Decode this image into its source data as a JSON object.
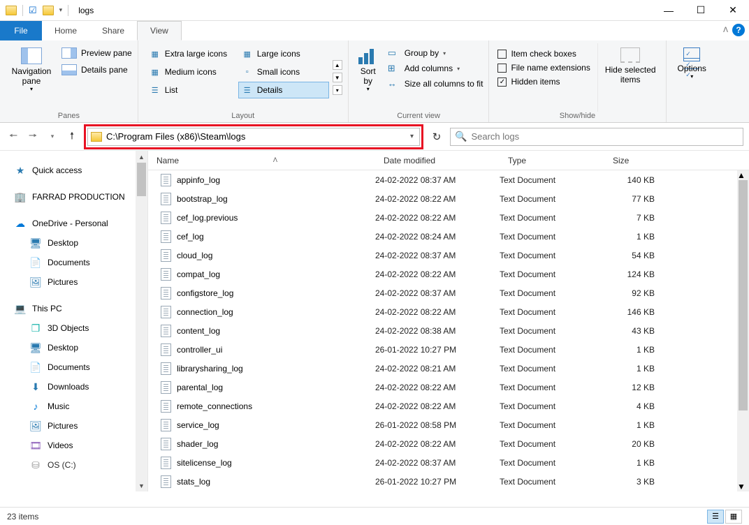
{
  "titlebar": {
    "title": "logs"
  },
  "tabs": {
    "file": "File",
    "home": "Home",
    "share": "Share",
    "view": "View"
  },
  "ribbon": {
    "panes": {
      "group": "Panes",
      "navigation": "Navigation\npane",
      "preview": "Preview pane",
      "details": "Details pane"
    },
    "layout": {
      "group": "Layout",
      "options": [
        "Extra large icons",
        "Large icons",
        "Medium icons",
        "Small icons",
        "List",
        "Details"
      ]
    },
    "current_view": {
      "group": "Current view",
      "sort": "Sort\nby",
      "group_by": "Group by",
      "add_cols": "Add columns",
      "size_all": "Size all columns to fit"
    },
    "showhide": {
      "group": "Show/hide",
      "item_check": "Item check boxes",
      "file_ext": "File name extensions",
      "hidden": "Hidden items",
      "hidden_checked": true,
      "hide_sel": "Hide selected\nitems"
    },
    "options": {
      "label": "Options"
    }
  },
  "addressbar": {
    "path": "C:\\Program Files (x86)\\Steam\\logs"
  },
  "search": {
    "placeholder": "Search logs"
  },
  "sidebar": {
    "quick": "Quick access",
    "prod": "FARRAD PRODUCTION",
    "onedrive": "OneDrive - Personal",
    "onedrive_children": [
      "Desktop",
      "Documents",
      "Pictures"
    ],
    "thispc": "This PC",
    "thispc_children": [
      "3D Objects",
      "Desktop",
      "Documents",
      "Downloads",
      "Music",
      "Pictures",
      "Videos",
      "OS (C:)"
    ]
  },
  "columns": {
    "name": "Name",
    "date": "Date modified",
    "type": "Type",
    "size": "Size"
  },
  "files": [
    {
      "name": "appinfo_log",
      "date": "24-02-2022 08:37 AM",
      "type": "Text Document",
      "size": "140 KB"
    },
    {
      "name": "bootstrap_log",
      "date": "24-02-2022 08:22 AM",
      "type": "Text Document",
      "size": "77 KB"
    },
    {
      "name": "cef_log.previous",
      "date": "24-02-2022 08:22 AM",
      "type": "Text Document",
      "size": "7 KB"
    },
    {
      "name": "cef_log",
      "date": "24-02-2022 08:24 AM",
      "type": "Text Document",
      "size": "1 KB"
    },
    {
      "name": "cloud_log",
      "date": "24-02-2022 08:37 AM",
      "type": "Text Document",
      "size": "54 KB"
    },
    {
      "name": "compat_log",
      "date": "24-02-2022 08:22 AM",
      "type": "Text Document",
      "size": "124 KB"
    },
    {
      "name": "configstore_log",
      "date": "24-02-2022 08:37 AM",
      "type": "Text Document",
      "size": "92 KB"
    },
    {
      "name": "connection_log",
      "date": "24-02-2022 08:22 AM",
      "type": "Text Document",
      "size": "146 KB"
    },
    {
      "name": "content_log",
      "date": "24-02-2022 08:38 AM",
      "type": "Text Document",
      "size": "43 KB"
    },
    {
      "name": "controller_ui",
      "date": "26-01-2022 10:27 PM",
      "type": "Text Document",
      "size": "1 KB"
    },
    {
      "name": "librarysharing_log",
      "date": "24-02-2022 08:21 AM",
      "type": "Text Document",
      "size": "1 KB"
    },
    {
      "name": "parental_log",
      "date": "24-02-2022 08:22 AM",
      "type": "Text Document",
      "size": "12 KB"
    },
    {
      "name": "remote_connections",
      "date": "24-02-2022 08:22 AM",
      "type": "Text Document",
      "size": "4 KB"
    },
    {
      "name": "service_log",
      "date": "26-01-2022 08:58 PM",
      "type": "Text Document",
      "size": "1 KB"
    },
    {
      "name": "shader_log",
      "date": "24-02-2022 08:22 AM",
      "type": "Text Document",
      "size": "20 KB"
    },
    {
      "name": "sitelicense_log",
      "date": "24-02-2022 08:37 AM",
      "type": "Text Document",
      "size": "1 KB"
    },
    {
      "name": "stats_log",
      "date": "26-01-2022 10:27 PM",
      "type": "Text Document",
      "size": "3 KB"
    }
  ],
  "status": {
    "items": "23 items"
  }
}
